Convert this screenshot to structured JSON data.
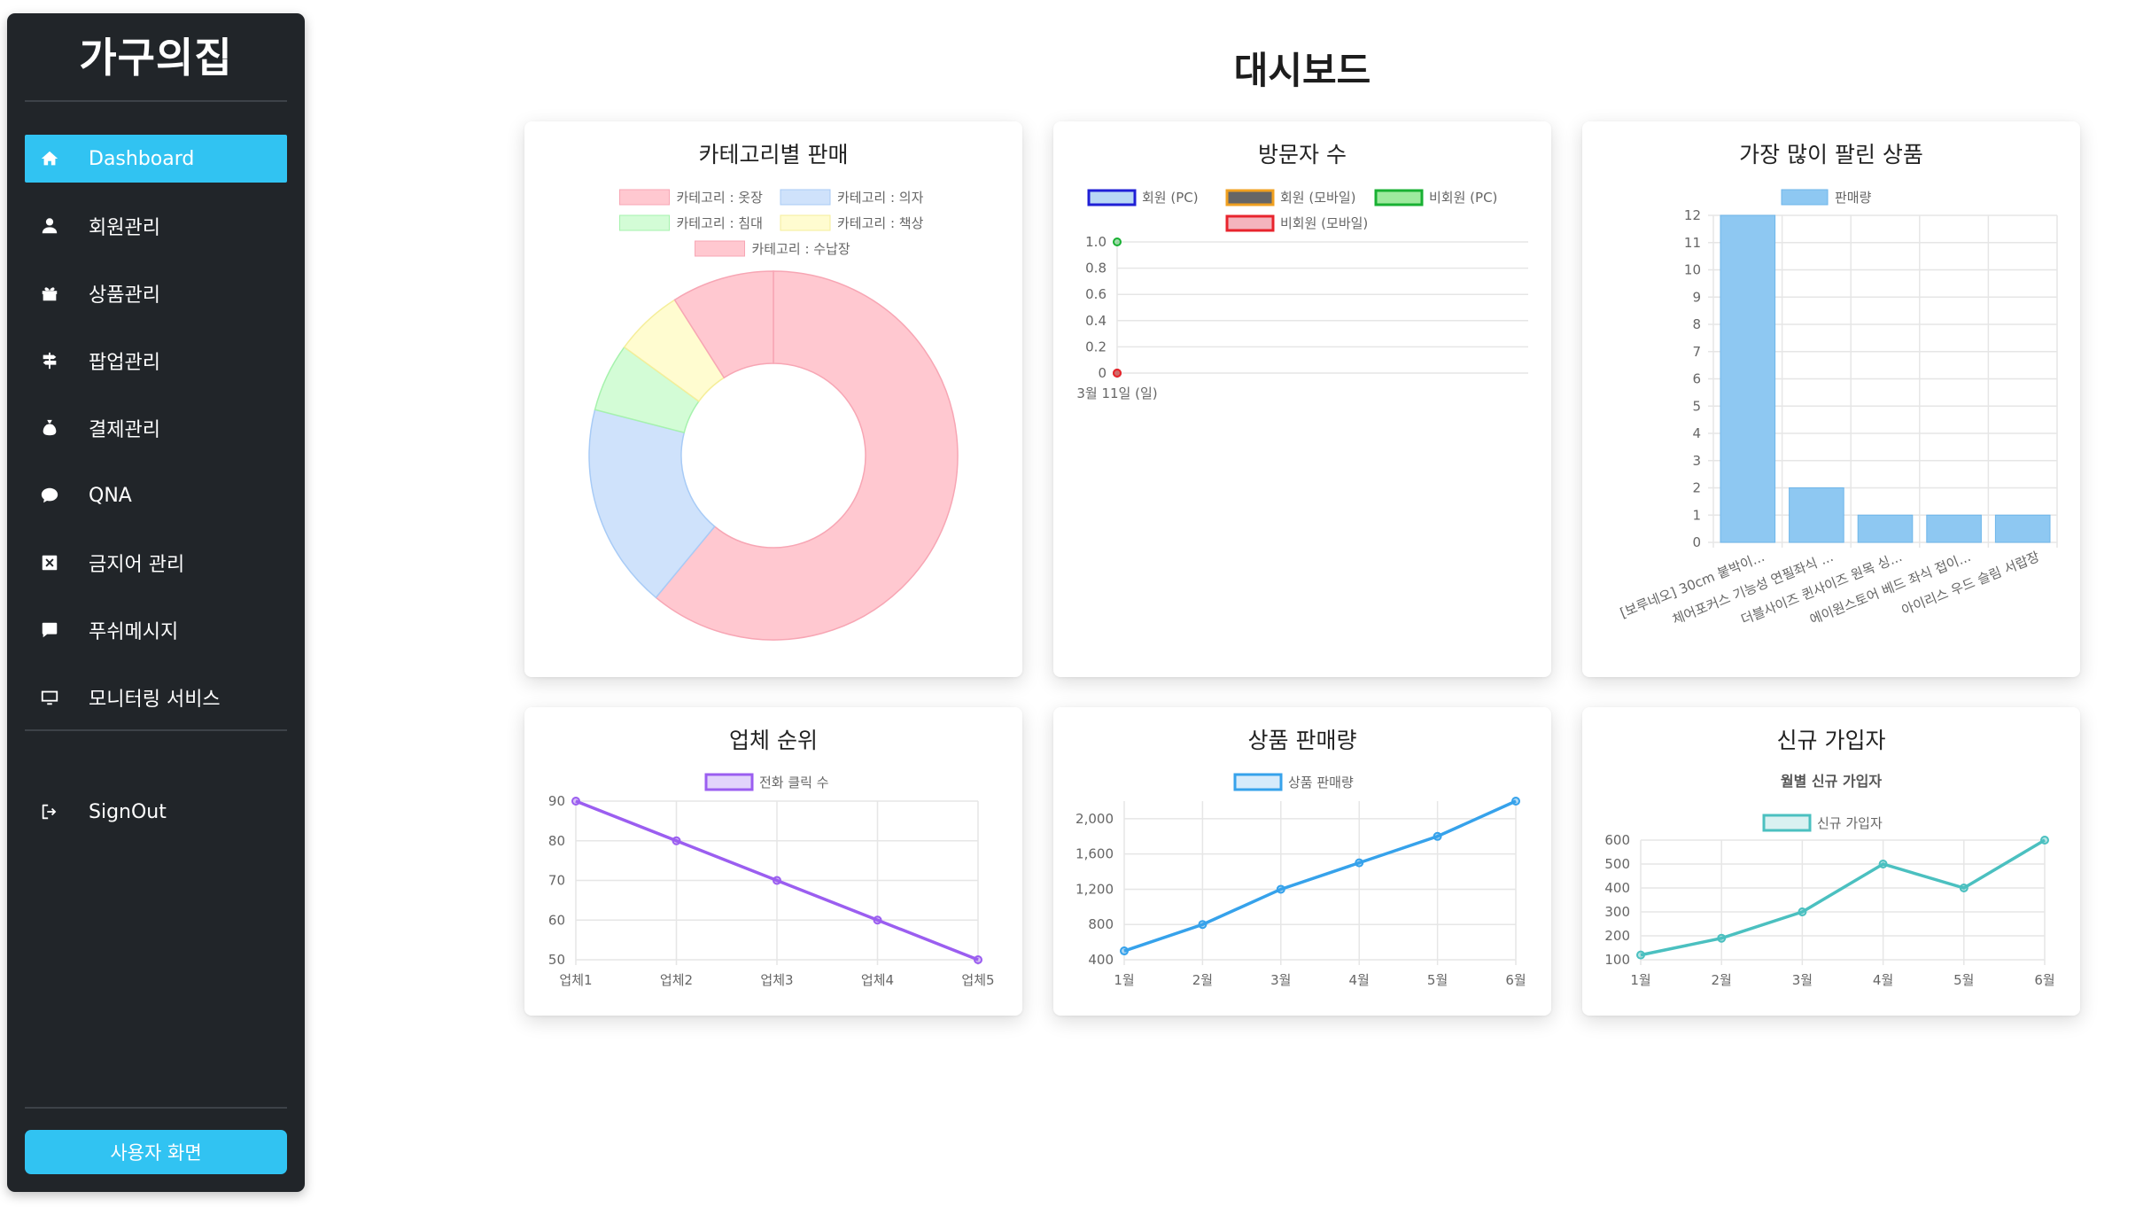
{
  "sidebar": {
    "logo": "가구의집",
    "items": [
      {
        "label": "Dashboard",
        "icon": "home-icon",
        "active": true
      },
      {
        "label": "회원관리",
        "icon": "user-icon"
      },
      {
        "label": "상품관리",
        "icon": "gift-icon"
      },
      {
        "label": "팝업관리",
        "icon": "signpost-icon"
      },
      {
        "label": "결제관리",
        "icon": "money-bag-icon"
      },
      {
        "label": "QNA",
        "icon": "chat-icon"
      },
      {
        "label": "금지어 관리",
        "icon": "forbidden-icon"
      },
      {
        "label": "푸쉬메시지",
        "icon": "message-icon"
      },
      {
        "label": "모니터링 서비스",
        "icon": "monitor-icon"
      }
    ],
    "signout": {
      "label": "SignOut",
      "icon": "signout-icon"
    },
    "user_button": "사용자 화면",
    "accent_color": "#31c3f2",
    "background_color": "#212529"
  },
  "page": {
    "title": "대시보드"
  },
  "cards": {
    "category": {
      "title": "카테고리별 판매"
    },
    "visitors": {
      "title": "방문자 수"
    },
    "top_products": {
      "title": "가장 많이 팔린 상품"
    },
    "vendor_rank": {
      "title": "업체 순위"
    },
    "product_sales": {
      "title": "상품 판매량"
    },
    "new_members": {
      "title": "신규 가입자"
    }
  },
  "chart_data": [
    {
      "id": "category",
      "type": "pie",
      "variant": "doughnut",
      "labels": [
        "카테고리 : 옷장",
        "카테고리 : 의자",
        "카테고리 : 침대",
        "카테고리 : 책상",
        "카테고리 : 수납장"
      ],
      "values": [
        61,
        18,
        6,
        6,
        9
      ],
      "colors": [
        "#ffc8d0",
        "#cfe2fb",
        "#d3fcd6",
        "#fffcd0",
        "#ffc8d0"
      ],
      "legend": "top"
    },
    {
      "id": "visitors",
      "type": "line",
      "categories": [
        "3월 11일 (일)"
      ],
      "series": [
        {
          "name": "회원 (PC)",
          "values": [
            0
          ],
          "color": "#1f1fd6"
        },
        {
          "name": "회원 (모바일)",
          "values": [
            0
          ],
          "color": "#f0a020"
        },
        {
          "name": "비회원 (PC)",
          "values": [
            1
          ],
          "color": "#19b033"
        },
        {
          "name": "비회원 (모바일)",
          "values": [
            0
          ],
          "color": "#e8242d"
        }
      ],
      "yticks": [
        "1.0",
        "0.8",
        "0.6",
        "0.4",
        "0.2",
        "0"
      ],
      "ylim": [
        0,
        1
      ],
      "grid": true,
      "legend": "top"
    },
    {
      "id": "top_products",
      "type": "bar",
      "categories": [
        "[보루네오] 30cm 붙박이...",
        "체어포커스 기능성 연필좌식 ...",
        "더블사이즈 퀸사이즈 원목 싱...",
        "에이원스토어 베드 좌식 접이...",
        "아이리스 우드 슬림 서랍장"
      ],
      "series": [
        {
          "name": "판매량",
          "values": [
            12,
            2,
            1,
            1,
            1
          ],
          "color": "#8ec8f2"
        }
      ],
      "ylim": [
        0,
        12
      ],
      "grid": true,
      "legend": "top"
    },
    {
      "id": "vendor_rank",
      "type": "line",
      "categories": [
        "업체1",
        "업체2",
        "업체3",
        "업체4",
        "업체5"
      ],
      "series": [
        {
          "name": "전화 클릭 수",
          "values": [
            90,
            80,
            70,
            60,
            50
          ],
          "color": "#9b5ef0"
        }
      ],
      "ylim": [
        50,
        90
      ],
      "yticks": [
        "90",
        "80",
        "70",
        "60",
        "50"
      ],
      "grid": true,
      "legend": "top"
    },
    {
      "id": "product_sales",
      "type": "line",
      "categories": [
        "1월",
        "2월",
        "3월",
        "4월",
        "5월",
        "6월"
      ],
      "series": [
        {
          "name": "상품 판매량",
          "values": [
            500,
            800,
            1200,
            1500,
            1800,
            2200
          ],
          "color": "#36a2eb"
        }
      ],
      "ylim": [
        400,
        2200
      ],
      "yticks": [
        "2,000",
        "1,600",
        "1,200",
        "800",
        "400"
      ],
      "grid": true,
      "legend": "top"
    },
    {
      "id": "new_members",
      "type": "line",
      "title": "월별 신규 가입자",
      "categories": [
        "1월",
        "2월",
        "3월",
        "4월",
        "5월",
        "6월"
      ],
      "series": [
        {
          "name": "신규 가입자",
          "values": [
            120,
            190,
            300,
            500,
            400,
            600
          ],
          "color": "#4bc0c0"
        }
      ],
      "ylim": [
        100,
        600
      ],
      "yticks": [
        "600",
        "500",
        "400",
        "300",
        "200",
        "100"
      ],
      "grid": true,
      "legend": "top"
    }
  ]
}
